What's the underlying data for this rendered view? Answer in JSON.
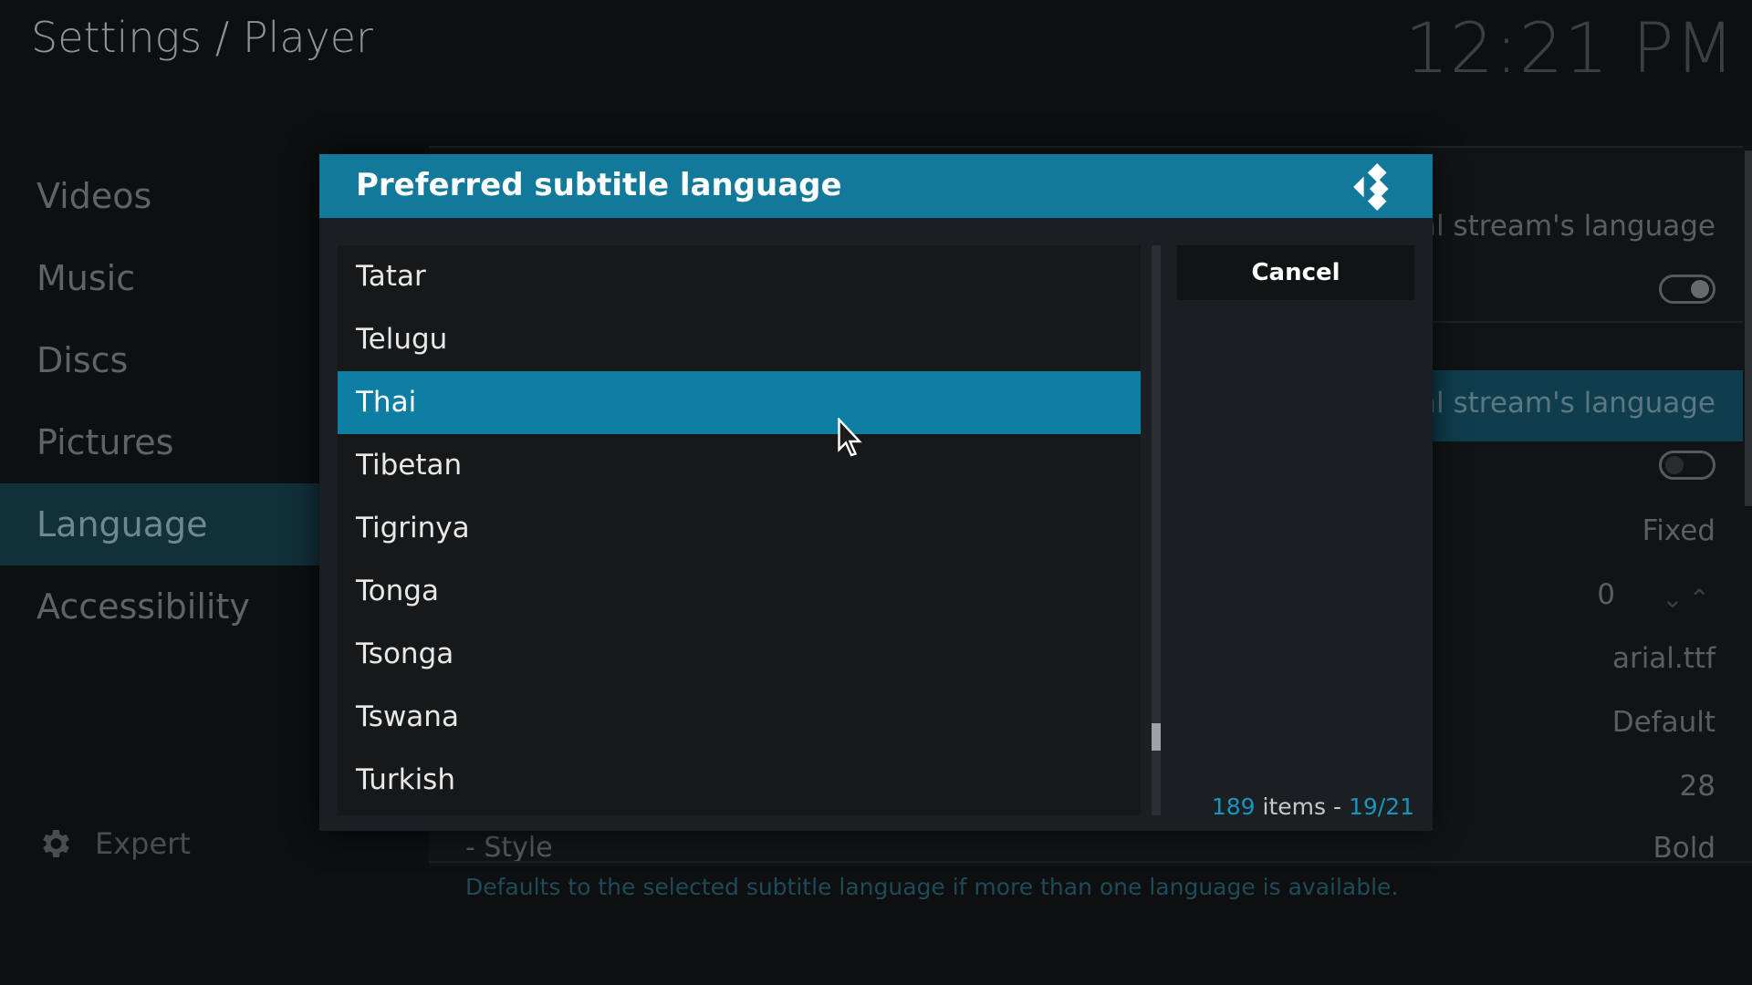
{
  "header": {
    "title": "Settings / Player",
    "clock": "12:21 PM"
  },
  "sidebar": {
    "items": [
      {
        "label": "Videos"
      },
      {
        "label": "Music"
      },
      {
        "label": "Discs"
      },
      {
        "label": "Pictures"
      },
      {
        "label": "Language"
      },
      {
        "label": "Accessibility"
      }
    ],
    "active": "Language",
    "expert_label": "Expert"
  },
  "background": {
    "row1_value": "ginal stream's language",
    "row3_value": "ginal stream's language",
    "row5_value": "Fixed",
    "row6_value": "0",
    "row7_value": "arial.ttf",
    "row8_value": "Default",
    "row9_value": "28",
    "style_label": "- Style",
    "style_value": "Bold",
    "help_text": "Defaults to the selected subtitle language if more than one language is available."
  },
  "dialog": {
    "title": "Preferred subtitle language",
    "cancel_label": "Cancel",
    "items": [
      "Tatar",
      "Telugu",
      "Thai",
      "Tibetan",
      "Tigrinya",
      "Tonga",
      "Tsonga",
      "Tswana",
      "Turkish"
    ],
    "selected": "Thai",
    "count_num": "189",
    "count_text": " items - ",
    "page": "19/21",
    "scroll_position": 0.88
  },
  "colors": {
    "accent": "#12799a",
    "selected_item": "#0f7ea3",
    "count_accent": "#1a93bf"
  },
  "icons": {
    "logo": "kodi-logo-icon",
    "expert": "gear-icon",
    "pointer": "mouse-pointer-icon"
  }
}
